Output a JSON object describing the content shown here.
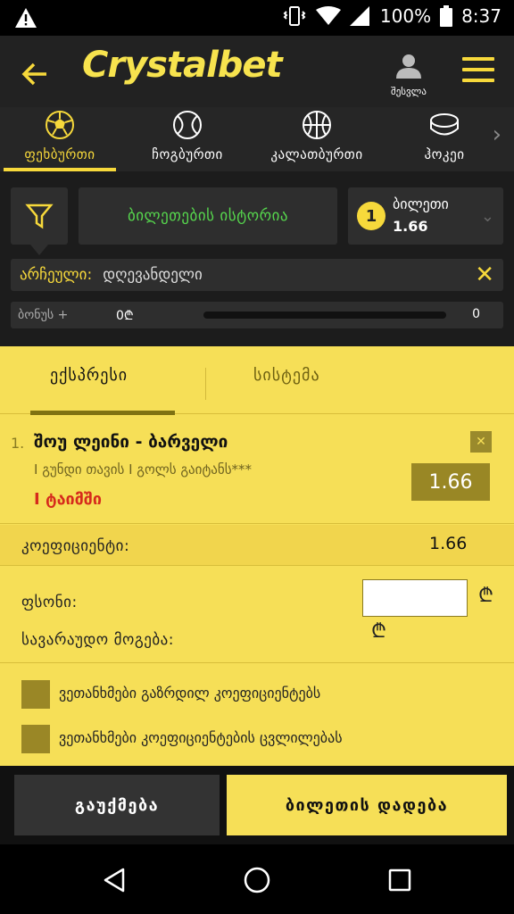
{
  "status_bar": {
    "battery": "100%",
    "time": "8:37"
  },
  "header": {
    "logo": "Crystalbet",
    "user_label": "შესვლა"
  },
  "sports_tabs": [
    {
      "label": "ფეხბურთი",
      "icon": "soccer-ball-icon",
      "active": true
    },
    {
      "label": "ჩოგბურთი",
      "icon": "tennis-ball-icon",
      "active": false
    },
    {
      "label": "კალათბურთი",
      "icon": "basketball-icon",
      "active": false
    },
    {
      "label": "ჰოკეი",
      "icon": "hockey-puck-icon",
      "active": false
    }
  ],
  "controls": {
    "history_label": "ბილეთების ისტორია",
    "ticket_count": "1",
    "ticket_label": "ბილეთი",
    "ticket_odds": "1.66",
    "selected_key": "არჩეული:",
    "selected_value": "დღევანდელი",
    "bonus_label": "ბონუს +",
    "bonus_value": "0₾",
    "bonus_end": "0"
  },
  "slip": {
    "tab_express": "ექსპრესი",
    "tab_system": "სისტემა",
    "bet": {
      "index": "1.",
      "match": "შოუ ლეინი - ბარველი",
      "market": "I გუნდი თავის I გოლს გაიტანს***",
      "period": "I ტაიმში",
      "odd": "1.66"
    },
    "coef_label": "კოეფიციენტი:",
    "coef_value": "1.66",
    "stake_label": "ფსონი:",
    "stake_value": "",
    "currency": "₾",
    "potential_label": "სავარაუდო მოგება:",
    "option1": "ვეთანხმები გაზრდილ კოეფიციენტებს",
    "option2": "ვეთანხმები კოეფიციენტების ცვლილებას"
  },
  "actions": {
    "cancel": "გაუქმება",
    "place": "ბილეთის დადება"
  },
  "colors": {
    "accent": "#f7d93b",
    "panel": "#f6df57",
    "dark": "#1c1c1c",
    "green": "#56d64d",
    "red": "#d62b1c"
  }
}
